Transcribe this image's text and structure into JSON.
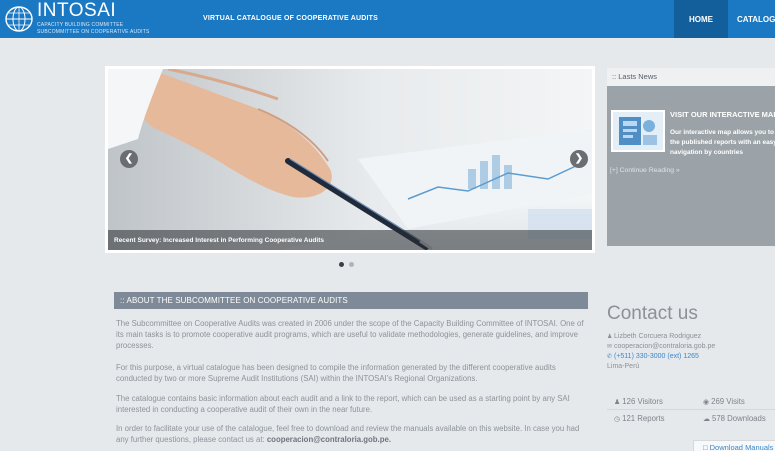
{
  "header": {
    "brand_name": "INTOSAI",
    "brand_sub_1": "CAPACITY BUILDING COMMITTEE",
    "brand_sub_2": "SUBCOMMITTEE ON COOPERATIVE AUDITS",
    "site_title": "VIRTUAL CATALOGUE OF COOPERATIVE AUDITS",
    "nav": {
      "home": "HOME",
      "catalog": "CATALOG"
    }
  },
  "carousel": {
    "caption": "Recent Survey: Increased Interest in Performing Cooperative Audits",
    "prev_icon": "chevron-left-icon",
    "next_icon": "chevron-right-icon",
    "slide_count": 2,
    "active_slide": 1
  },
  "about": {
    "heading": ":: ABOUT THE SUBCOMMITTEE ON COOPERATIVE AUDITS",
    "p1": "The Subcommittee on Cooperative Audits was created in 2006 under the scope of the Capacity Building Committee of INTOSAI. One of its main tasks is to promote cooperative audit programs, which are useful to validate methodologies, generate guidelines, and improve processes.",
    "p2": "For this purpose, a virtual catalogue has been designed to compile the information generated by the different cooperative audits conducted by two or more Supreme Audit Institutions (SAI) within the INTOSAI's Regional Organizations.",
    "p3": "The catalogue contains basic information about each audit and a link to the report, which can be used as a starting point by any SAI interested in conducting a cooperative audit of their own in the near future.",
    "p4": "In order to facilitate your use of the catalogue, feel free to download and review the manuals available on this website. In case you had any further questions, please contact us at:",
    "p4_email": "cooperacion@contraloria.gob.pe."
  },
  "news": {
    "heading": ":: Lasts News",
    "item_title": "VISIT OUR INTERACTIVE MAP",
    "item_body": "Our interactive map allows you to find the published reports with an easy navigation by countries",
    "more_link": "[+] Continue Reading »"
  },
  "contact": {
    "title": "Contact us",
    "name": "Lizbeth Corcuera Rodriguez",
    "email": "cooperacion@contraloria.gob.pe",
    "phone": "(+511) 330-3000 (ext) 1265",
    "location": "Lima-Perú"
  },
  "stats": {
    "visitors": "126 Visitors",
    "visits": "269 Visits",
    "reports": "121 Reports",
    "downloads": "578 Downloads"
  },
  "download_button": "Download Manuals",
  "colors": {
    "header_blue": "#1b78c3",
    "nav_active": "#135f9c",
    "about_head_bg": "#7e8a98",
    "link_blue": "#3b86c8",
    "page_bg": "#e5e9ec"
  }
}
